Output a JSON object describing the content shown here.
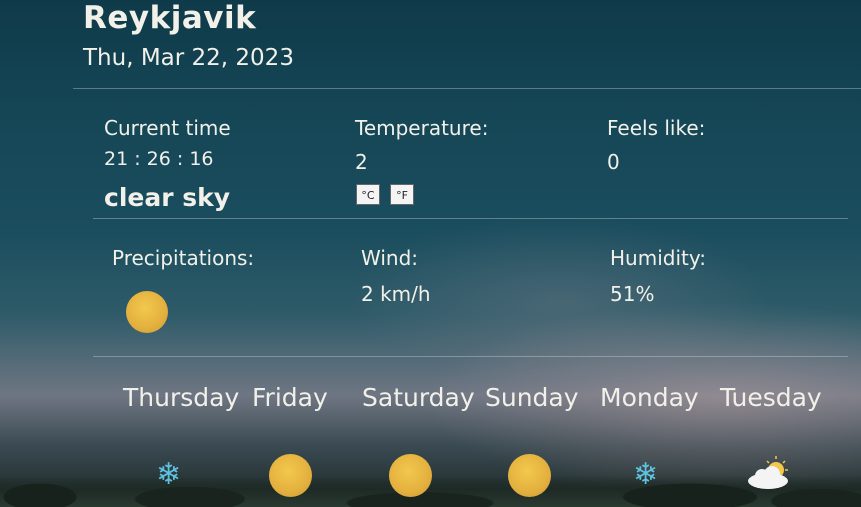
{
  "location": {
    "city": "Reykjavik",
    "date": "Thu, Mar 22, 2023"
  },
  "current": {
    "time_label": "Current time",
    "time_value": "21 : 26 : 16",
    "description": "clear sky",
    "temperature_label": "Temperature:",
    "temperature_value": "2",
    "celsius_button": "°C",
    "fahrenheit_button": "°F",
    "feels_like_label": "Feels like:",
    "feels_like_value": "0"
  },
  "details": {
    "precipitation_label": "Precipitations:",
    "precipitation_icon": "sun-icon",
    "wind_label": "Wind:",
    "wind_value": "2 km/h",
    "humidity_label": "Humidity:",
    "humidity_value": "51%"
  },
  "forecast": [
    {
      "day": "Thursday",
      "icon": "snowflake-icon"
    },
    {
      "day": "Friday",
      "icon": "sun-icon"
    },
    {
      "day": "Saturday",
      "icon": "sun-icon"
    },
    {
      "day": "Sunday",
      "icon": "sun-icon"
    },
    {
      "day": "Monday",
      "icon": "snowflake-icon"
    },
    {
      "day": "Tuesday",
      "icon": "partly-cloudy-icon"
    }
  ],
  "colors": {
    "text": "#f1f1ea",
    "sun": "#e3b03e",
    "snow": "#5fc2e0"
  }
}
